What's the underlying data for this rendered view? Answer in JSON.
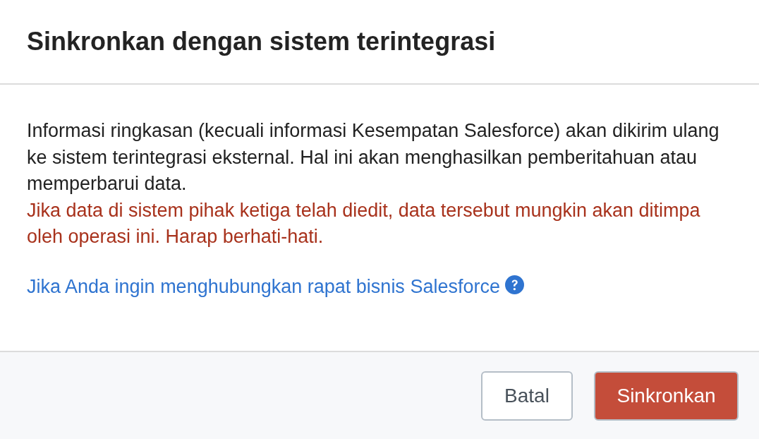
{
  "dialog": {
    "title": "Sinkronkan dengan sistem terintegrasi",
    "paragraphs": [
      {
        "kind": "normal",
        "text": "Informasi ringkasan (kecuali informasi Kesempatan Salesforce) akan dikirim ulang ke sistem terintegrasi eksternal. Hal ini akan menghasilkan pemberitahuan atau memperbarui data."
      },
      {
        "kind": "warning",
        "text": "Jika data di sistem pihak ketiga telah diedit, data tersebut mungkin akan ditimpa oleh operasi ini. Harap berhati-hati."
      }
    ],
    "link": {
      "text": "Jika Anda ingin menghubungkan rapat bisnis Salesforce"
    },
    "buttons": [
      {
        "label": "Batal",
        "kind": "secondary"
      },
      {
        "label": "Sinkronkan",
        "kind": "primary"
      }
    ]
  }
}
